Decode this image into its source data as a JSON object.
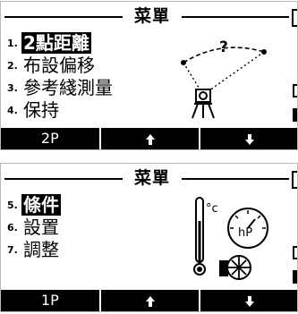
{
  "screen1": {
    "title": "菜單",
    "items": [
      {
        "num": "1.",
        "label": "2點距離",
        "selected": true
      },
      {
        "num": "2.",
        "label": "布設偏移",
        "selected": false
      },
      {
        "num": "3.",
        "label": "參考綫測量",
        "selected": false
      },
      {
        "num": "4.",
        "label": "保持",
        "selected": false
      }
    ],
    "illustration_text": "?",
    "softkeys": [
      {
        "label": "2P",
        "icon": "none"
      },
      {
        "label": "",
        "icon": "arrow-up-icon"
      },
      {
        "label": "",
        "icon": "arrow-down-icon"
      }
    ]
  },
  "screen2": {
    "title": "菜單",
    "items": [
      {
        "num": "5.",
        "label": "條件",
        "selected": true
      },
      {
        "num": "6.",
        "label": "設置",
        "selected": false
      },
      {
        "num": "7.",
        "label": "調整",
        "selected": false
      }
    ],
    "thermometer_unit": "°c",
    "barometer_unit": "hP",
    "softkeys": [
      {
        "label": "1P",
        "icon": "none"
      },
      {
        "label": "",
        "icon": "arrow-up-icon"
      },
      {
        "label": "",
        "icon": "arrow-down-icon"
      }
    ]
  },
  "colors": {
    "background": "#ffffff",
    "foreground": "#000000"
  }
}
